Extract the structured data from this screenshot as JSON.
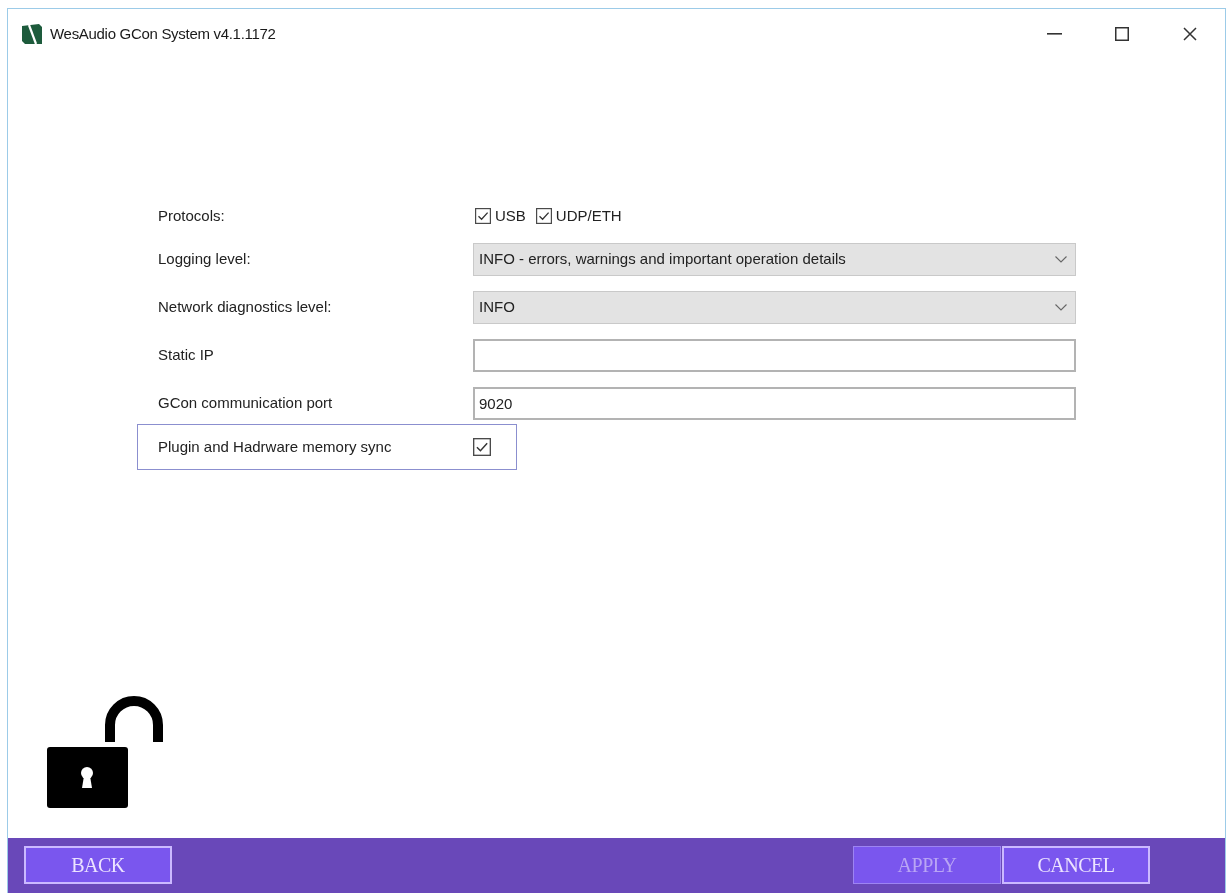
{
  "window": {
    "title": "WesAudio GCon System v4.1.1172"
  },
  "settings": [
    {
      "kind": "checkboxes",
      "label": "Protocols:",
      "focused": false,
      "options": [
        {
          "label": "USB",
          "checked": true
        },
        {
          "label": "UDP/ETH",
          "checked": true
        }
      ]
    },
    {
      "kind": "dropdown",
      "label": "Logging level:",
      "focused": false,
      "value": "INFO - errors, warnings and important operation details"
    },
    {
      "kind": "dropdown",
      "label": "Network diagnostics level:",
      "focused": false,
      "value": "INFO"
    },
    {
      "kind": "text",
      "label": "Static IP",
      "focused": false
    },
    {
      "kind": "text",
      "label": "GCon communication port",
      "focused": false,
      "value": "9020"
    },
    {
      "kind": "checkbox",
      "label": "Plugin and Hadrware memory sync",
      "focused": true,
      "checked": true
    }
  ],
  "lock": {
    "locked": false
  },
  "footer": {
    "left_buttons": [
      {
        "label": "BACK",
        "disabled": false
      }
    ],
    "right_buttons": [
      {
        "label": "APPLY",
        "disabled": true
      },
      {
        "label": "CANCEL",
        "disabled": false
      }
    ]
  }
}
